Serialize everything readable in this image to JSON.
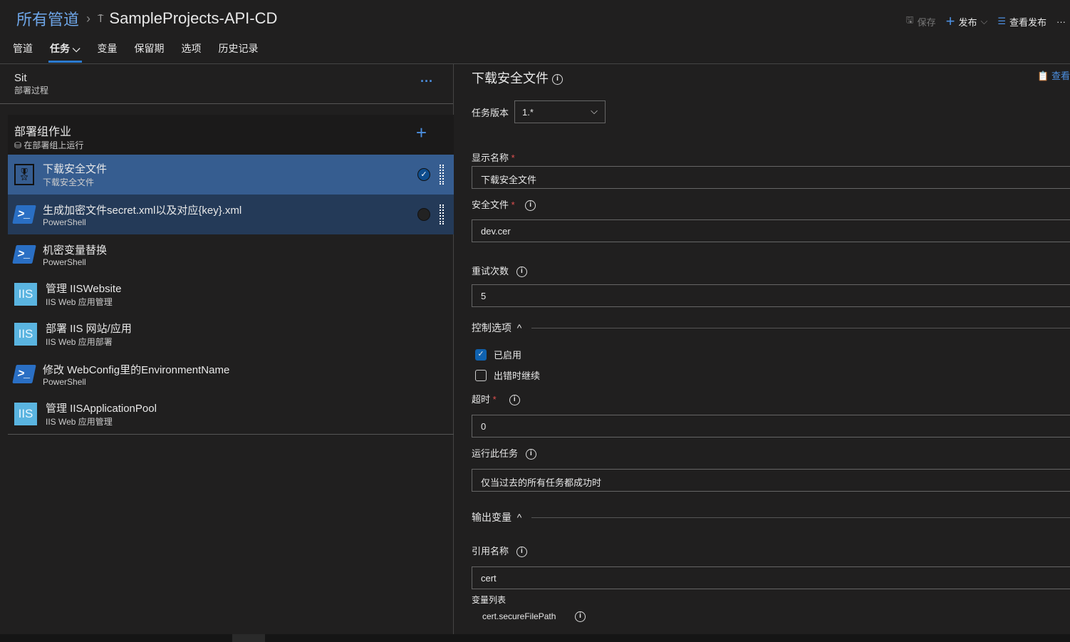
{
  "breadcrumb": {
    "root": "所有管道",
    "pipeline": "SampleProjects-API-CD"
  },
  "tabs": [
    "管道",
    "任务",
    "变量",
    "保留期",
    "选项",
    "历史记录"
  ],
  "actions": {
    "save": "保存",
    "release": "发布",
    "view_releases": "查看发布",
    "more": "···"
  },
  "stage": {
    "name": "Sit",
    "subtitle": "部署过程",
    "more": "···"
  },
  "job": {
    "title": "部署组作业",
    "subtitle": "在部署组上运行"
  },
  "tasks": [
    {
      "title": "下载安全文件",
      "subtitle": "下载安全文件",
      "icon": "secure-file-icon",
      "selected": true
    },
    {
      "title": "生成加密文件secret.xml以及对应{key}.xml",
      "subtitle": "PowerShell",
      "icon": "powershell-icon"
    },
    {
      "title": "机密变量替换",
      "subtitle": "PowerShell",
      "icon": "powershell-icon"
    },
    {
      "title": "管理 IISWebsite",
      "subtitle": "IIS Web 应用管理",
      "icon": "iis-icon"
    },
    {
      "title": "部署 IIS 网站/应用",
      "subtitle": "IIS Web 应用部署",
      "icon": "iis-icon"
    },
    {
      "title": "修改 WebConfig里的EnvironmentName",
      "subtitle": "PowerShell",
      "icon": "powershell-icon"
    },
    {
      "title": "管理 IISApplicationPool",
      "subtitle": "IIS Web 应用管理",
      "icon": "iis-icon"
    }
  ],
  "detail": {
    "title": "下载安全文件",
    "view_link": "查看",
    "version_label": "任务版本",
    "version_value": "1.*",
    "display_name_label": "显示名称",
    "display_name_value": "下载安全文件",
    "secure_file_label": "安全文件",
    "secure_file_value": "dev.cer",
    "retry_label": "重试次数",
    "retry_value": "5",
    "control_section": "控制选项",
    "enabled_label": "已启用",
    "continue_label": "出错时继续",
    "timeout_label": "超时",
    "timeout_value": "0",
    "run_label": "运行此任务",
    "run_value": "仅当过去的所有任务都成功时",
    "output_section": "输出变量",
    "ref_label": "引用名称",
    "ref_value": "cert",
    "var_list_label": "变量列表",
    "var_name": "cert.secureFilePath"
  },
  "icons": {
    "ps_glyph": ">_",
    "iis_glyph": "IIS",
    "check": "✓",
    "info": "i",
    "req": "*",
    "plus": "+",
    "chev_down": "⌵",
    "chev_up": "^"
  }
}
